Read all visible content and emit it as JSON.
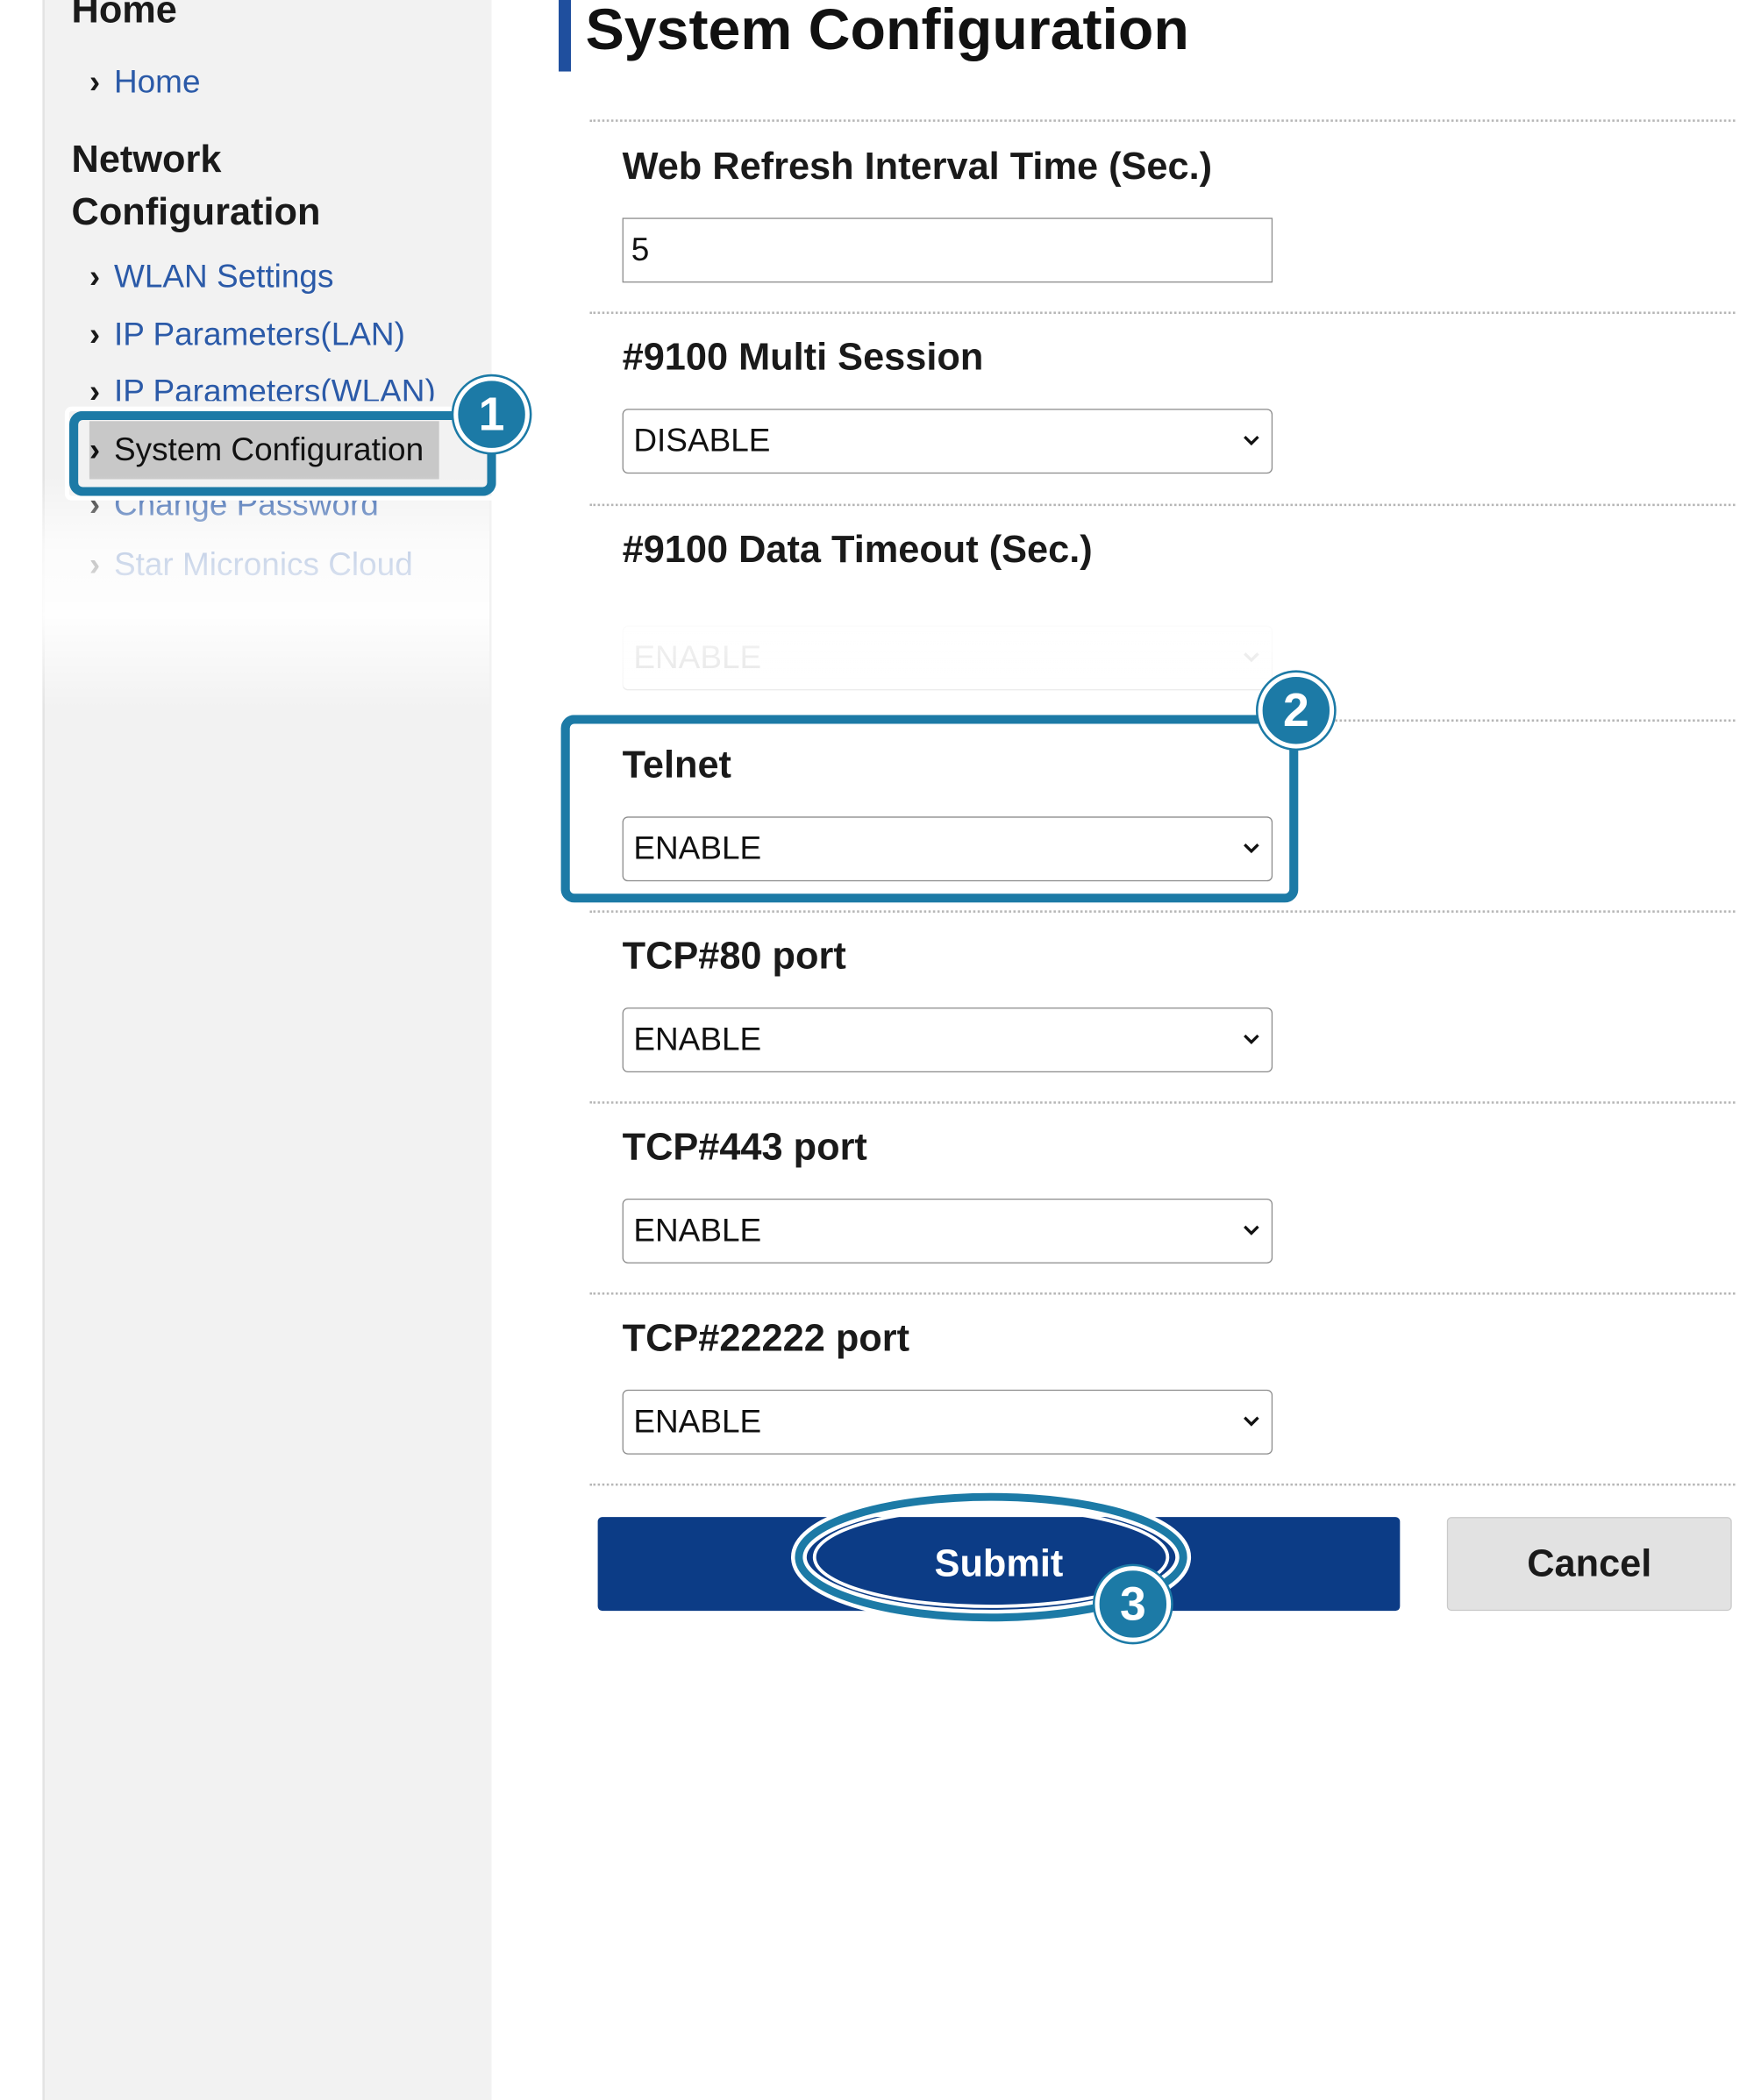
{
  "sidebar": {
    "home_heading": "Home",
    "home_link": "Home",
    "network_heading_line1": "Network",
    "network_heading_line2": "Configuration",
    "items": [
      {
        "label": "WLAN Settings"
      },
      {
        "label": "IP Parameters(LAN)"
      },
      {
        "label": "IP Parameters(WLAN)"
      },
      {
        "label": "System Configuration",
        "active": true
      },
      {
        "label": "Change Password"
      },
      {
        "label": "Star Micronics Cloud"
      }
    ]
  },
  "main": {
    "title": "System Configuration",
    "fields": [
      {
        "label": "Web Refresh Interval Time (Sec.)",
        "type": "text",
        "value": "5"
      },
      {
        "label": "#9100 Multi Session",
        "type": "select",
        "value": "DISABLE"
      },
      {
        "label": "#9100 Data Timeout (Sec.)",
        "type": "select",
        "value": "ENABLE"
      },
      {
        "label": "Telnet",
        "type": "select",
        "value": "ENABLE"
      },
      {
        "label": "TCP#80 port",
        "type": "select",
        "value": "ENABLE"
      },
      {
        "label": "TCP#443 port",
        "type": "select",
        "value": "ENABLE"
      },
      {
        "label": "TCP#22222 port",
        "type": "select",
        "value": "ENABLE"
      }
    ],
    "submit_label": "Submit",
    "cancel_label": "Cancel"
  },
  "callouts": [
    "1",
    "2",
    "3"
  ],
  "colors": {
    "accent": "#1f4f9e",
    "submit": "#0c3c86",
    "callout": "#1c7aa6",
    "link": "#2b5aa8",
    "sidebar_bg": "#f2f2f2"
  }
}
